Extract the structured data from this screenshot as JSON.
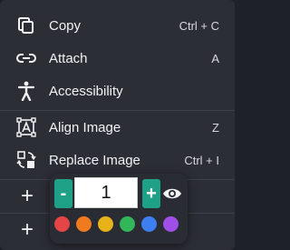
{
  "menu": {
    "items": [
      {
        "label": "Copy",
        "shortcut": "Ctrl + C",
        "icon": "copy-icon"
      },
      {
        "label": "Attach",
        "shortcut": "A",
        "icon": "link-icon"
      },
      {
        "label": "Accessibility",
        "shortcut": "",
        "icon": "accessibility-icon"
      },
      {
        "label": "Align Image",
        "shortcut": "Z",
        "icon": "align-image-icon"
      },
      {
        "label": "Replace Image",
        "shortcut": "Ctrl + I",
        "icon": "replace-image-icon"
      }
    ],
    "extra_rows": [
      {
        "icon": "plus-icon",
        "glyph": "+"
      },
      {
        "icon": "plus-icon",
        "glyph": "+"
      }
    ]
  },
  "popover": {
    "stepper": {
      "minus": "-",
      "value": "1",
      "plus": "+"
    },
    "visibility_icon": "eye-icon",
    "colors": [
      "#e64545",
      "#f07a1f",
      "#e8b21a",
      "#33b55a",
      "#3d7ff0",
      "#a04ee8"
    ]
  }
}
